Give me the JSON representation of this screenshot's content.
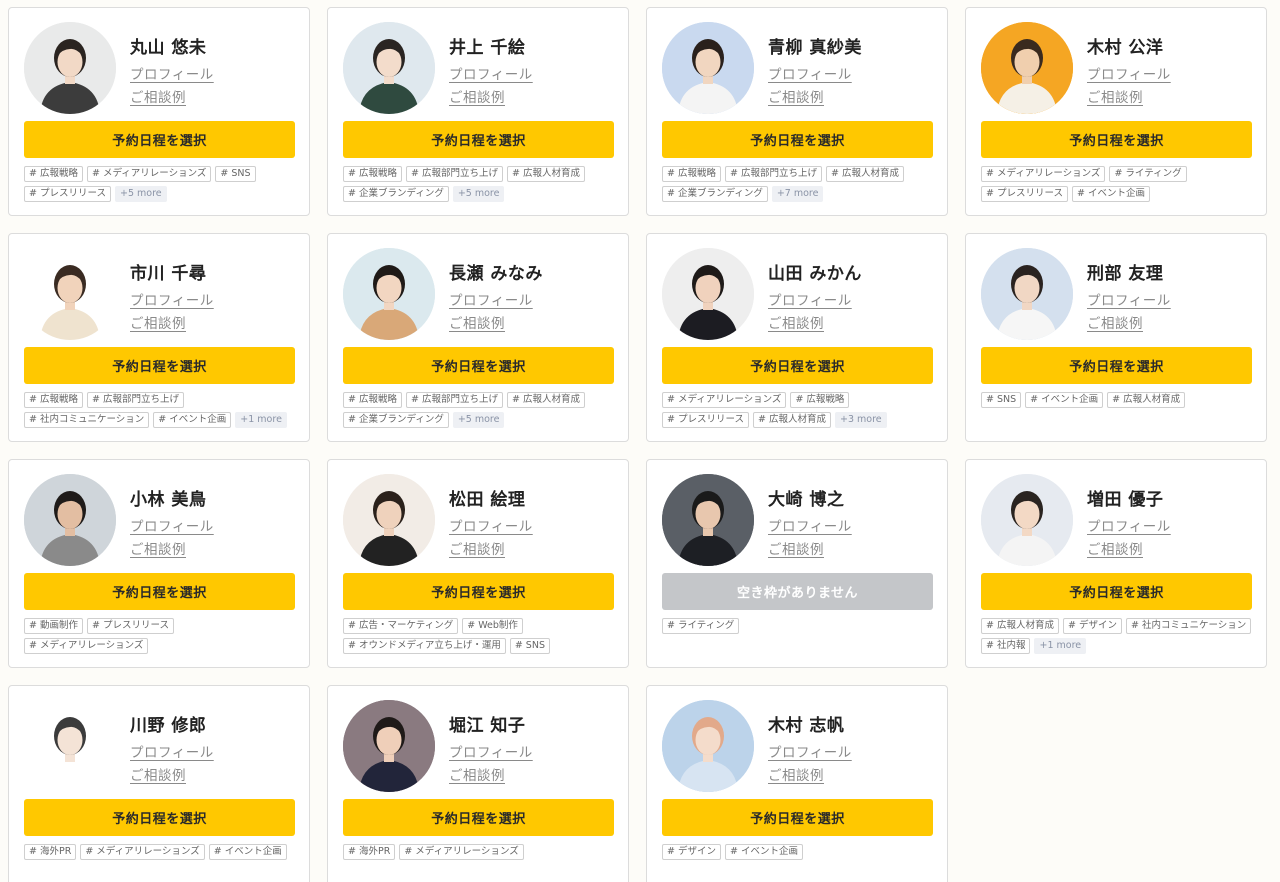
{
  "labels": {
    "profile": "プロフィール",
    "cases": "ご相談例",
    "book": "予約日程を選択",
    "unavailable": "空き枠がありません"
  },
  "colors": {
    "accent": "#ffc800",
    "disabled": "#c4c6c9",
    "page_bg": "#fdfcf8"
  },
  "advisors": [
    {
      "name": "丸山 悠未",
      "avatar_bg": "#e9eaea",
      "hair": "#2b2420",
      "skin": "#f2d9c6",
      "shirt": "#3c3c3c",
      "available": true,
      "tags": [
        "# 広報戦略",
        "# メディアリレーションズ",
        "# SNS",
        "# プレスリリース"
      ],
      "more": "+5 more"
    },
    {
      "name": "井上 千絵",
      "avatar_bg": "#dfe8ee",
      "hair": "#2a2522",
      "skin": "#f3dccb",
      "shirt": "#2f4a3f",
      "available": true,
      "tags": [
        "# 広報戦略",
        "# 広報部門立ち上げ",
        "# 広報人材育成",
        "# 企業ブランディング"
      ],
      "more": "+5 more"
    },
    {
      "name": "青柳 真紗美",
      "avatar_bg": "#c9d9ef",
      "hair": "#2a211c",
      "skin": "#f1d6c0",
      "shirt": "#f4f4f4",
      "available": true,
      "tags": [
        "# 広報戦略",
        "# 広報部門立ち上げ",
        "# 広報人材育成",
        "# 企業ブランディング"
      ],
      "more": "+7 more"
    },
    {
      "name": "木村 公洋",
      "avatar_bg": "#f5a623",
      "hair": "#3a2a1e",
      "skin": "#f0cfae",
      "shirt": "#f5f0e6",
      "available": true,
      "tags": [
        "# メディアリレーションズ",
        "# ライティング",
        "# プレスリリース",
        "# イベント企画"
      ],
      "more": ""
    },
    {
      "name": "市川 千尋",
      "avatar_bg": "#ffffff",
      "hair": "#3a2b22",
      "skin": "#f1d3bb",
      "shirt": "#efe3cf",
      "available": true,
      "tags": [
        "# 広報戦略",
        "# 広報部門立ち上げ",
        "# 社内コミュニケーション",
        "# イベント企画"
      ],
      "more": "+1 more"
    },
    {
      "name": "長瀬 みなみ",
      "avatar_bg": "#dbe9ee",
      "hair": "#1f1a17",
      "skin": "#f2d6c1",
      "shirt": "#d9a878",
      "available": true,
      "tags": [
        "# 広報戦略",
        "# 広報部門立ち上げ",
        "# 広報人材育成",
        "# 企業ブランディング"
      ],
      "more": "+5 more"
    },
    {
      "name": "山田 みかん",
      "avatar_bg": "#eeeeee",
      "hair": "#1e1a18",
      "skin": "#f0d2bd",
      "shirt": "#1c1c22",
      "available": true,
      "tags": [
        "# メディアリレーションズ",
        "# 広報戦略",
        "# プレスリリース",
        "# 広報人材育成"
      ],
      "more": "+3 more"
    },
    {
      "name": "刑部 友理",
      "avatar_bg": "#d4e0ee",
      "hair": "#2a2320",
      "skin": "#f1d7c4",
      "shirt": "#f6f6f6",
      "available": true,
      "tags": [
        "# SNS",
        "# イベント企画",
        "# 広報人材育成"
      ],
      "more": ""
    },
    {
      "name": "小林 美鳥",
      "avatar_bg": "#cfd5da",
      "hair": "#1f1b19",
      "skin": "#e3bea2",
      "shirt": "#8a8a8a",
      "available": true,
      "tags": [
        "# 動画制作",
        "# プレスリリース",
        "# メディアリレーションズ"
      ],
      "more": ""
    },
    {
      "name": "松田 絵理",
      "avatar_bg": "#f2ece6",
      "hair": "#2b211b",
      "skin": "#efd2bc",
      "shirt": "#222222",
      "available": true,
      "tags": [
        "# 広告・マーケティング",
        "# Web制作",
        "# オウンドメディア立ち上げ・運用",
        "# SNS"
      ],
      "more": ""
    },
    {
      "name": "大崎 博之",
      "avatar_bg": "#5a5f66",
      "hair": "#1a1a1a",
      "skin": "#e8c7ae",
      "shirt": "#1d1f24",
      "available": false,
      "tags": [
        "# ライティング"
      ],
      "more": ""
    },
    {
      "name": "増田 優子",
      "avatar_bg": "#e6eaf0",
      "hair": "#2a2420",
      "skin": "#f3d9c5",
      "shirt": "#f4f4f4",
      "available": true,
      "tags": [
        "# 広報人材育成",
        "# デザイン",
        "# 社内コミュニケーション",
        "# 社内報"
      ],
      "more": "+1 more"
    },
    {
      "name": "川野 修郎",
      "avatar_bg": "#ffffff",
      "hair": "#3b3b3b",
      "skin": "#f4e3d6",
      "shirt": "#ffffff",
      "available": true,
      "tags": [
        "# 海外PR",
        "# メディアリレーションズ",
        "# イベント企画"
      ],
      "more": ""
    },
    {
      "name": "堀江 知子",
      "avatar_bg": "#8a7a80",
      "hair": "#1f1a18",
      "skin": "#efcfb9",
      "shirt": "#22253a",
      "available": true,
      "tags": [
        "# 海外PR",
        "# メディアリレーションズ"
      ],
      "more": ""
    },
    {
      "name": "木村 志帆",
      "avatar_bg": "#bcd3ea",
      "hair": "#e2a98a",
      "skin": "#f4dccb",
      "shirt": "#d7e4f2",
      "available": true,
      "tags": [
        "# デザイン",
        "# イベント企画"
      ],
      "more": ""
    }
  ]
}
